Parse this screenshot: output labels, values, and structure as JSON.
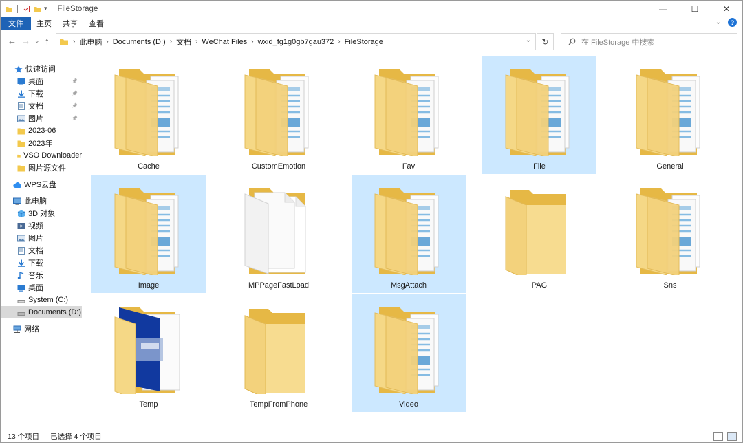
{
  "window": {
    "title": "FileStorage",
    "minimize": "—",
    "maximize": "☐",
    "close": "✕"
  },
  "ribbon": {
    "tabs": [
      "文件",
      "主页",
      "共享",
      "查看"
    ],
    "collapse": "⌄",
    "help": "?"
  },
  "nav": {
    "back": "←",
    "forward": "→",
    "recent": "⌄",
    "up": "↑",
    "breadcrumb": [
      "此电脑",
      "Documents (D:)",
      "文档",
      "WeChat Files",
      "wxid_fg1g0gb7gau372",
      "FileStorage"
    ],
    "breadcrumb_sep": "›",
    "dropdown": "⌄",
    "refresh": "↻",
    "search_placeholder": "在 FileStorage 中搜索"
  },
  "sidebar": {
    "quick_access": "快速访问",
    "quick_items": [
      {
        "label": "桌面",
        "icon": "desktop-icon",
        "pinned": true
      },
      {
        "label": "下载",
        "icon": "download-icon",
        "pinned": true
      },
      {
        "label": "文档",
        "icon": "documents-icon",
        "pinned": true
      },
      {
        "label": "图片",
        "icon": "pictures-icon",
        "pinned": true
      },
      {
        "label": "2023-06",
        "icon": "folder-icon",
        "pinned": false
      },
      {
        "label": "2023年",
        "icon": "folder-icon",
        "pinned": false
      },
      {
        "label": "VSO Downloader",
        "icon": "folder-icon",
        "pinned": false
      },
      {
        "label": "图片源文件",
        "icon": "folder-icon",
        "pinned": false
      }
    ],
    "wps": "WPS云盘",
    "this_pc": "此电脑",
    "pc_items": [
      {
        "label": "3D 对象",
        "icon": "3d-objects-icon"
      },
      {
        "label": "视频",
        "icon": "videos-icon"
      },
      {
        "label": "图片",
        "icon": "pictures-icon"
      },
      {
        "label": "文档",
        "icon": "documents-icon"
      },
      {
        "label": "下载",
        "icon": "download-icon"
      },
      {
        "label": "音乐",
        "icon": "music-icon"
      },
      {
        "label": "桌面",
        "icon": "desktop-icon"
      },
      {
        "label": "System (C:)",
        "icon": "drive-icon"
      },
      {
        "label": "Documents (D:)",
        "icon": "drive-icon",
        "selected": true
      }
    ],
    "network": "网络",
    "pin_glyph": "📌"
  },
  "folders": [
    {
      "name": "Cache",
      "type": "docs",
      "selected": false
    },
    {
      "name": "CustomEmotion",
      "type": "docs",
      "selected": false
    },
    {
      "name": "Fav",
      "type": "docs",
      "selected": false
    },
    {
      "name": "File",
      "type": "docs",
      "selected": true
    },
    {
      "name": "General",
      "type": "docs",
      "selected": false
    },
    {
      "name": "Image",
      "type": "docs",
      "selected": true
    },
    {
      "name": "MPPageFastLoad",
      "type": "white",
      "selected": false
    },
    {
      "name": "MsgAttach",
      "type": "docs",
      "selected": true
    },
    {
      "name": "PAG",
      "type": "empty",
      "selected": false
    },
    {
      "name": "Sns",
      "type": "docs",
      "selected": false
    },
    {
      "name": "Temp",
      "type": "blue",
      "selected": false
    },
    {
      "name": "TempFromPhone",
      "type": "empty",
      "selected": false
    },
    {
      "name": "Video",
      "type": "docs",
      "selected": true
    }
  ],
  "status": {
    "count": "13 个项目",
    "selected": "已选择 4 个项目"
  }
}
